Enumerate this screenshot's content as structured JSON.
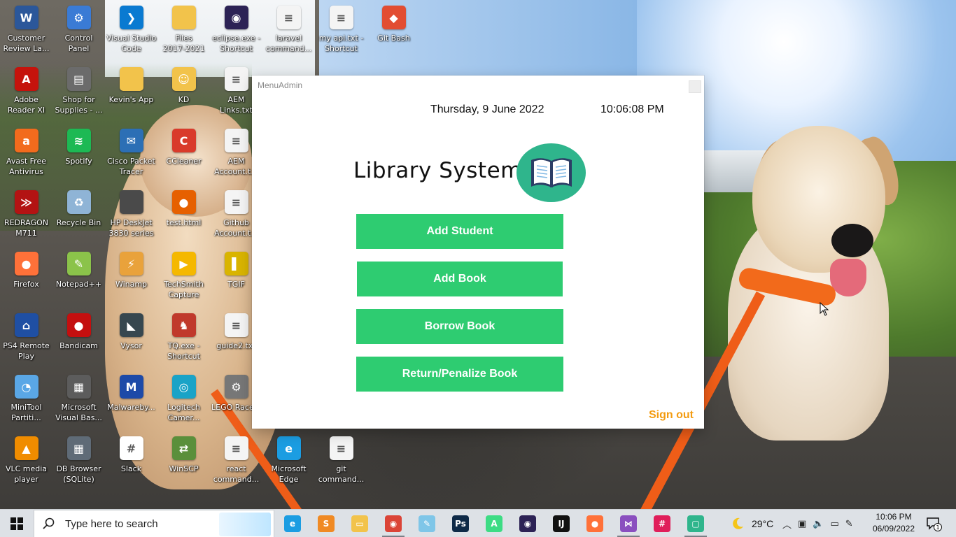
{
  "desktop": {
    "icons": [
      {
        "label": "Customer\nReview La...",
        "icon": "word-doc-icon",
        "color": "#2b579a",
        "glyph": "W"
      },
      {
        "label": "Control\nPanel",
        "icon": "control-panel-icon",
        "color": "#3a7bd5",
        "glyph": "⚙"
      },
      {
        "label": "Visual Studio\nCode",
        "icon": "vscode-icon",
        "color": "#0a7ad1",
        "glyph": "❯"
      },
      {
        "label": "Files\n2017-2021",
        "icon": "folder-icon",
        "color": "#f2c34b",
        "glyph": ""
      },
      {
        "label": "eclipse.exe -\nShortcut",
        "icon": "eclipse-icon",
        "color": "#2c2255",
        "glyph": "◉"
      },
      {
        "label": "laravel\ncommand...",
        "icon": "text-file-icon",
        "color": "#f4f4f4",
        "glyph": "≡"
      },
      {
        "label": "my api.txt -\nShortcut",
        "icon": "text-file-icon",
        "color": "#f4f4f4",
        "glyph": "≡"
      },
      {
        "label": "Git Bash",
        "icon": "git-bash-icon",
        "color": "#e24d32",
        "glyph": "◆"
      },
      {
        "label": "Adobe\nReader XI",
        "icon": "adobe-reader-icon",
        "color": "#c5130c",
        "glyph": "A"
      },
      {
        "label": "Shop for\nSupplies - ...",
        "icon": "printer-icon",
        "color": "#6b6b6b",
        "glyph": "▤"
      },
      {
        "label": "Kevin's App",
        "icon": "folder-icon",
        "color": "#f2c34b",
        "glyph": ""
      },
      {
        "label": "KD",
        "icon": "user-folder-icon",
        "color": "#f2c34b",
        "glyph": "☺"
      },
      {
        "label": "AEM\nLinks.txt",
        "icon": "text-file-icon",
        "color": "#f4f4f4",
        "glyph": "≡"
      },
      {
        "label": "Avast Free\nAntivirus",
        "icon": "avast-icon",
        "color": "#f26b1d",
        "glyph": "a"
      },
      {
        "label": "Spotify",
        "icon": "spotify-icon",
        "color": "#1db954",
        "glyph": "≋"
      },
      {
        "label": "Cisco Packet\nTracer",
        "icon": "cisco-packet-tracer-icon",
        "color": "#2c6fb5",
        "glyph": "✉"
      },
      {
        "label": "CCleaner",
        "icon": "ccleaner-icon",
        "color": "#d93a2b",
        "glyph": "C"
      },
      {
        "label": "AEM\nAccount.t...",
        "icon": "text-file-icon",
        "color": "#f4f4f4",
        "glyph": "≡"
      },
      {
        "label": "REDRAGON\nM711",
        "icon": "redragon-icon",
        "color": "#b31313",
        "glyph": "≫"
      },
      {
        "label": "Recycle Bin",
        "icon": "recycle-bin-icon",
        "color": "#8fb4d6",
        "glyph": "♻"
      },
      {
        "label": "HP DeskJet\n3830 series",
        "icon": "hp-printer-icon",
        "color": "#4a4a4a",
        "glyph": ""
      },
      {
        "label": "test.html",
        "icon": "firefox-html-icon",
        "color": "#e66000",
        "glyph": "●"
      },
      {
        "label": "Github\nAccount.t...",
        "icon": "text-file-icon",
        "color": "#f4f4f4",
        "glyph": "≡"
      },
      {
        "label": "Firefox",
        "icon": "firefox-icon",
        "color": "#ff7139",
        "glyph": "●"
      },
      {
        "label": "Notepad++",
        "icon": "notepad-plus-plus-icon",
        "color": "#8bc34a",
        "glyph": "✎"
      },
      {
        "label": "Winamp",
        "icon": "winamp-icon",
        "color": "#e9a23b",
        "glyph": "⚡"
      },
      {
        "label": "TechSmith\nCapture",
        "icon": "techsmith-capture-icon",
        "color": "#f5b800",
        "glyph": "▶"
      },
      {
        "label": "TGIF",
        "icon": "tgif-icon",
        "color": "#d9b400",
        "glyph": "▌"
      },
      {
        "label": "PS4 Remote\nPlay",
        "icon": "ps4-remote-play-icon",
        "color": "#1f4fa3",
        "glyph": "⌂"
      },
      {
        "label": "Bandicam",
        "icon": "bandicam-icon",
        "color": "#c40f0f",
        "glyph": "●"
      },
      {
        "label": "Vysor",
        "icon": "vysor-icon",
        "color": "#37474f",
        "glyph": "◣"
      },
      {
        "label": "TQ.exe -\nShortcut",
        "icon": "tq-icon",
        "color": "#c0392b",
        "glyph": "♞"
      },
      {
        "label": "guide2.txt",
        "icon": "text-file-icon",
        "color": "#f4f4f4",
        "glyph": "≡"
      },
      {
        "label": "MiniTool\nPartiti...",
        "icon": "minitool-icon",
        "color": "#5aa7e6",
        "glyph": "◔"
      },
      {
        "label": "Microsoft\nVisual Bas...",
        "icon": "visual-basic-icon",
        "color": "#5c5c5c",
        "glyph": "▦"
      },
      {
        "label": "Malwareby...",
        "icon": "malwarebytes-icon",
        "color": "#1d4aa8",
        "glyph": "M"
      },
      {
        "label": "Logitech\nCamer...",
        "icon": "logitech-camera-icon",
        "color": "#1aa3c7",
        "glyph": "◎"
      },
      {
        "label": "LEGO Racers",
        "icon": "lego-racers-icon",
        "color": "#777777",
        "glyph": "⚙"
      },
      {
        "label": "VLC media\nplayer",
        "icon": "vlc-icon",
        "color": "#f08c00",
        "glyph": "▲"
      },
      {
        "label": "DB Browser\n(SQLite)",
        "icon": "db-browser-icon",
        "color": "#5f6b77",
        "glyph": "▦"
      },
      {
        "label": "Slack",
        "icon": "slack-icon",
        "color": "#ffffff",
        "glyph": "#"
      },
      {
        "label": "WinSCP",
        "icon": "winscp-icon",
        "color": "#5a8f3b",
        "glyph": "⇄"
      },
      {
        "label": "react\ncommand...",
        "icon": "text-file-icon",
        "color": "#f4f4f4",
        "glyph": "≡"
      },
      {
        "label": "Microsoft\nEdge",
        "icon": "edge-icon",
        "color": "#1b9de2",
        "glyph": "e"
      },
      {
        "label": "git\ncommand...",
        "icon": "text-file-icon",
        "color": "#f4f4f4",
        "glyph": "≡"
      }
    ]
  },
  "window": {
    "title": "MenuAdmin",
    "date": "Thursday, 9 June 2022",
    "time": "10:06:08 PM",
    "app_title": "Library System",
    "logo_color": "#2fb58c",
    "buttons": {
      "add_student": "Add Student",
      "add_book": "Add Book",
      "borrow_book": "Borrow Book",
      "return_book": "Return/Penalize Book"
    },
    "button_color": "#2ecc71",
    "sign_out": "Sign out",
    "sign_out_color": "#f39c12"
  },
  "taskbar": {
    "search_placeholder": "Type here to search",
    "apps": [
      {
        "name": "edge-taskbar-icon",
        "color": "#1b9de2",
        "glyph": "e",
        "running": false
      },
      {
        "name": "sublime-text-taskbar-icon",
        "color": "#f08a24",
        "glyph": "S",
        "running": false
      },
      {
        "name": "file-explorer-taskbar-icon",
        "color": "#f2c34b",
        "glyph": "▭",
        "running": false
      },
      {
        "name": "chrome-taskbar-icon",
        "color": "#db4437",
        "glyph": "◉",
        "running": true
      },
      {
        "name": "notepad-taskbar-icon",
        "color": "#7fc6e8",
        "glyph": "✎",
        "running": false
      },
      {
        "name": "photoshop-taskbar-icon",
        "color": "#0e2a47",
        "glyph": "Ps",
        "running": false
      },
      {
        "name": "android-studio-taskbar-icon",
        "color": "#3ddc84",
        "glyph": "A",
        "running": false
      },
      {
        "name": "eclipse-taskbar-icon",
        "color": "#2c2255",
        "glyph": "◉",
        "running": false
      },
      {
        "name": "intellij-taskbar-icon",
        "color": "#111111",
        "glyph": "IJ",
        "running": false
      },
      {
        "name": "firefox-taskbar-icon",
        "color": "#ff7139",
        "glyph": "●",
        "running": false
      },
      {
        "name": "visual-studio-taskbar-icon",
        "color": "#8a4fbf",
        "glyph": "⋈",
        "running": true
      },
      {
        "name": "slack-taskbar-icon",
        "color": "#e01e5a",
        "glyph": "#",
        "running": false
      },
      {
        "name": "app-window-taskbar-icon",
        "color": "#2fb58c",
        "glyph": "▢",
        "running": true
      }
    ],
    "weather_temp": "29°C",
    "clock_time": "10:06 PM",
    "clock_date": "06/09/2022",
    "notification_count": "1"
  }
}
